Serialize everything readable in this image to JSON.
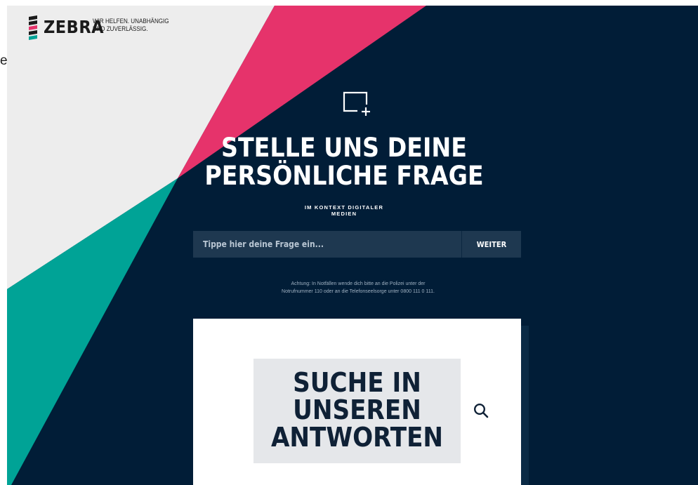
{
  "stray_text": "e",
  "brand": {
    "name": "ZEBRA",
    "tagline_line1": "WIR HELFEN. UNABHÄNGIG",
    "tagline_line2": "UND ZUVERLÄSSIG."
  },
  "hero": {
    "title_line1": "STELLE UNS DEINE",
    "title_line2": "PERSÖNLICHE FRAGE",
    "subtitle_line1": "IM KONTEXT DIGITALER",
    "subtitle_line2": "MEDIEN"
  },
  "question_form": {
    "placeholder": "Tippe hier deine Frage ein...",
    "value": "",
    "submit_label": "WEITER"
  },
  "emergency_note": {
    "line1": "Achtung: In Notfällen wende dich bitte an die Polizei unter der",
    "line2": "Notrufnummer 110 oder an die Telefonseelsorge unter 0800 111 0 111."
  },
  "search": {
    "label_line1": "SUCHE IN",
    "label_line2": "UNSEREN",
    "label_line3": "ANTWORTEN"
  },
  "colors": {
    "navy": "#011d37",
    "pink": "#e6336b",
    "teal": "#00a396",
    "light_gray": "#ededed"
  },
  "icons": {
    "add_question": "add-question-icon",
    "search": "search-icon",
    "logo": "zebra-stripes-logo"
  }
}
